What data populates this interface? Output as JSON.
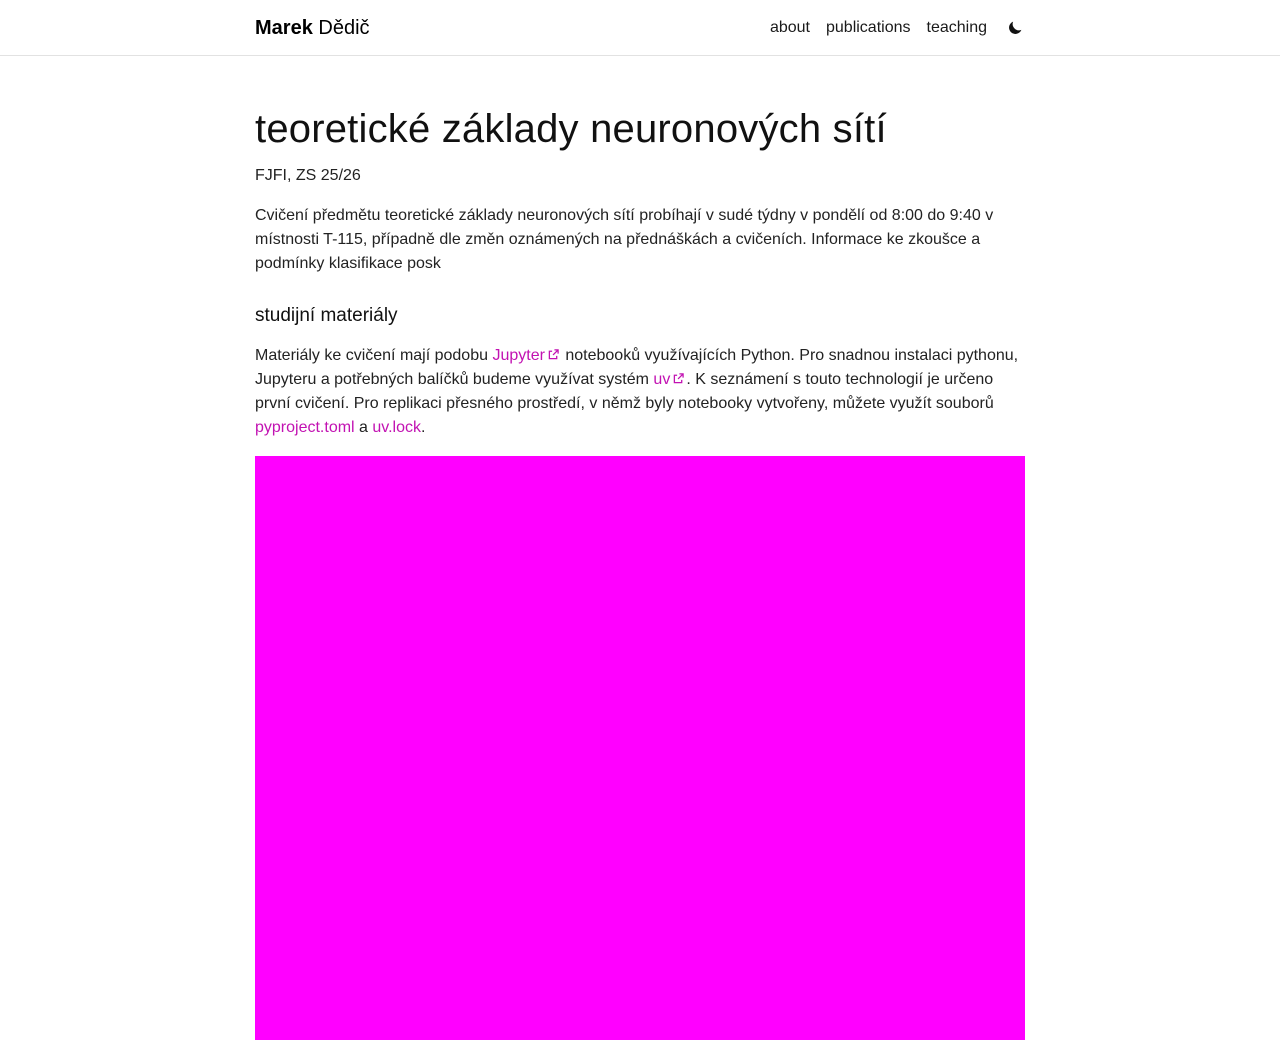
{
  "navbar": {
    "brand_first": "Marek",
    "brand_last": "Dědič",
    "links": {
      "about": "about",
      "publications": "publications",
      "teaching": "teaching"
    },
    "theme_icon": "moon-icon"
  },
  "page": {
    "title": "teoretické základy neuronových sítí",
    "subtitle": "FJFI, ZS 25/26",
    "intro": "Cvičení předmětu teoretické základy neuronových sítí probíhají v sudé týdny v pondělí od 8:00 do 9:40 v místnosti T-115, případně dle změn oznámených na přednáškách a cvičeních. Informace ke zkoušce a podmínky klasifikace posk"
  },
  "materials": {
    "heading": "studijní materiály",
    "text_1": "Materiály ke cvičení mají podobu ",
    "link_jupyter": "Jupyter",
    "text_2": " notebooků využívajících Python. Pro snadnou instalaci pythonu, Jupyteru a potřebných balíčků budeme využívat systém ",
    "link_uv": "uv",
    "text_3": ". K seznámení s touto technologií je určeno první cvičení. Pro replikaci přesného prostředí, v němž byly notebooky vytvořeny, můžete využít souborů ",
    "link_pyproject": "pyproject.toml",
    "text_4": " a ",
    "link_uvlock": "uv.lock",
    "text_5": "."
  },
  "colors": {
    "link": "#c212b2",
    "embed": "#ff00ff",
    "text": "#1a1a1a"
  }
}
